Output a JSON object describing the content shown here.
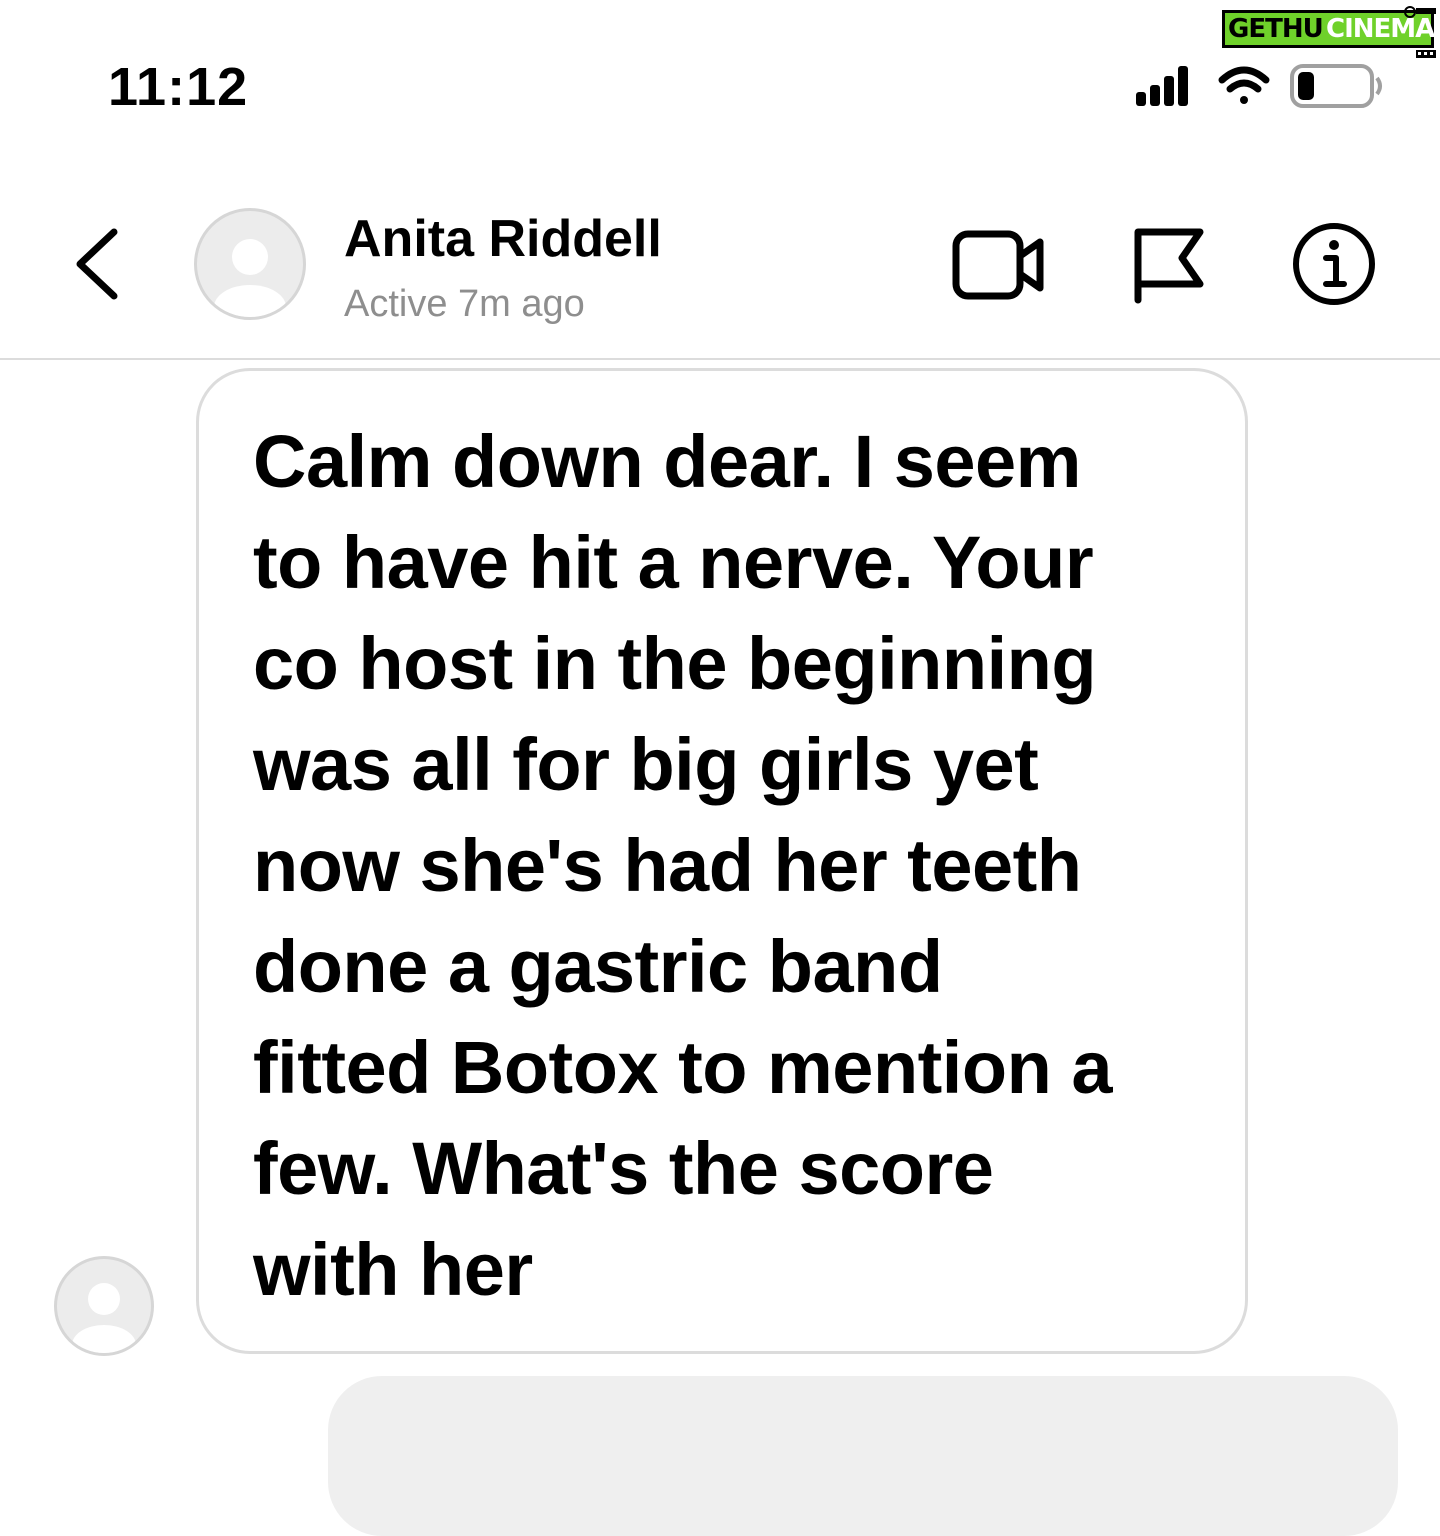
{
  "watermark": {
    "part_a": "GETHU",
    "part_b": "CINEMA"
  },
  "status_bar": {
    "time": "11:12",
    "icons": [
      "cellular-signal-icon",
      "wifi-icon",
      "battery-low-icon"
    ]
  },
  "header": {
    "contact_name": "Anita Riddell",
    "active_status": "Active 7m ago",
    "icons": [
      "chevron-left-icon",
      "video-call-icon",
      "flag-icon",
      "info-icon"
    ]
  },
  "messages": [
    {
      "direction": "received",
      "text": "Calm down dear. I seem\nto have hit a nerve. Your\nco host in the beginning\nwas all for big girls yet\nnow she's had her teeth\ndone a gastric band\nfitted Botox to mention a\nfew. What's the score\nwith her"
    }
  ],
  "colors": {
    "background": "#ffffff",
    "text": "#000000",
    "secondary_text": "#8e8e8e",
    "bubble_border": "#dcdcdc",
    "sent_bubble_bg": "#efefef",
    "avatar_placeholder": "#ececec",
    "watermark_green": "#6fd12a"
  }
}
